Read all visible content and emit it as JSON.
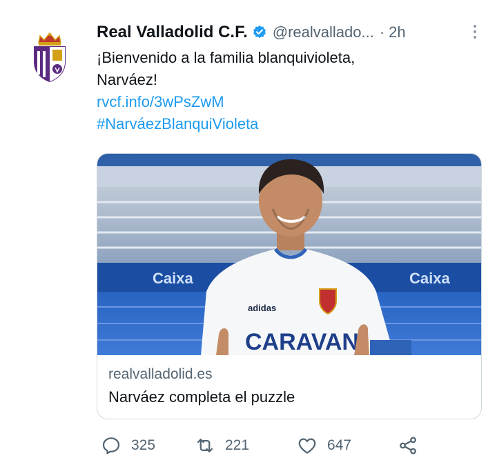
{
  "tweet": {
    "author_name": "Real Valladolid C.F.",
    "handle": "@realvallado...",
    "separator": "·",
    "time": "2h",
    "text_line1": "¡Bienvenido a la familia blanquivioleta,",
    "text_line2": "Narváez!",
    "link": "rvcf.info/3wPsZwM",
    "hashtag": "#NarváezBlanquiVioleta"
  },
  "card": {
    "domain": "realvalladolid.es",
    "title": "Narváez completa el puzzle",
    "image_text": {
      "jersey_sponsor": "CARAVAN",
      "jersey_brand": "adidas",
      "banner_left": "Caixa",
      "banner_right": "Caixa"
    }
  },
  "actions": {
    "replies": "325",
    "retweets": "221",
    "likes": "647"
  },
  "colors": {
    "accent_link": "#1d9bf0",
    "secondary_text": "#536471",
    "verified": "#1d9bf0",
    "club_purple": "#5b2b82"
  },
  "icons": {
    "reply": "reply-icon",
    "retweet": "retweet-icon",
    "like": "heart-icon",
    "share": "share-icon",
    "verified": "verified-badge-icon",
    "more": "more-options-icon"
  }
}
